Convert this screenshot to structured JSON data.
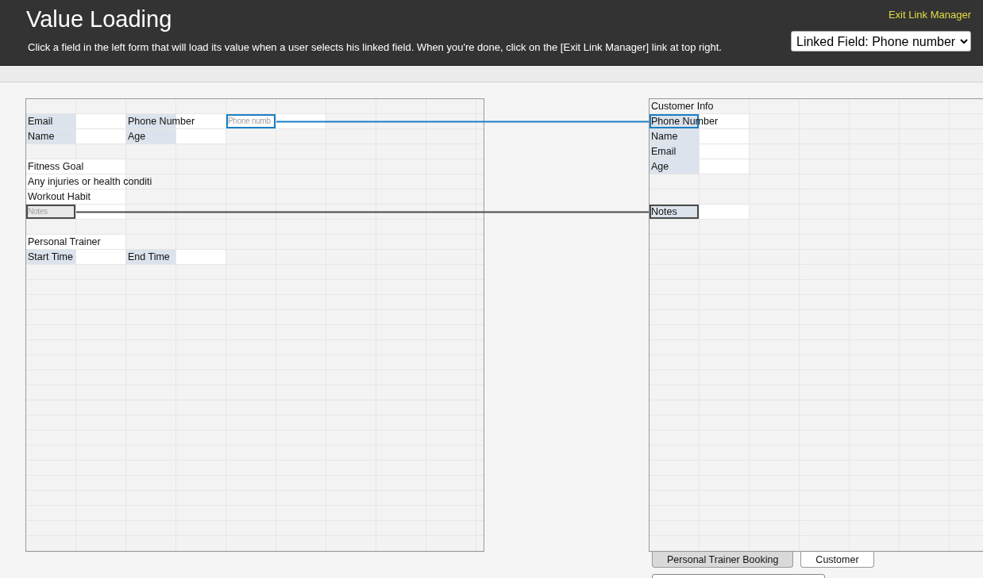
{
  "header": {
    "title": "Value Loading",
    "instruction": "Click a field in the left form that will load its value when a user selects his linked field. When you're done, click on the [Exit Link Manager] link at top right.",
    "exit_link": "Exit Link Manager",
    "linked_field": "Linked Field: Phone number"
  },
  "links": [
    {
      "selected": true
    },
    {
      "selected": false
    }
  ],
  "left_form": {
    "rows": [
      {
        "kind": "blank"
      },
      {
        "kind": "fields",
        "cells": [
          {
            "kind": "label",
            "text": "Email"
          },
          {
            "kind": "input"
          },
          {
            "kind": "label",
            "text": "Phone Number"
          },
          {
            "kind": "input"
          },
          {
            "kind": "input",
            "placeholder": "Phone numb",
            "linked": true
          },
          {
            "kind": "input"
          }
        ]
      },
      {
        "kind": "fields",
        "cells": [
          {
            "kind": "label",
            "text": "Name"
          },
          {
            "kind": "input"
          },
          {
            "kind": "label",
            "text": "Age"
          },
          {
            "kind": "input"
          }
        ]
      },
      {
        "kind": "blank"
      },
      {
        "kind": "fields",
        "cells": [
          {
            "kind": "wide-text",
            "text": "Fitness Goal"
          }
        ]
      },
      {
        "kind": "fields",
        "cells": [
          {
            "kind": "wide-text",
            "text": "Any injuries or health conditi"
          }
        ]
      },
      {
        "kind": "fields",
        "cells": [
          {
            "kind": "wide-text",
            "text": "Workout Habit"
          }
        ]
      },
      {
        "kind": "fields",
        "cells": [
          {
            "kind": "input",
            "placeholder": "Notes",
            "disabled": true,
            "linked": true
          },
          {
            "kind": "input"
          }
        ]
      },
      {
        "kind": "blank"
      },
      {
        "kind": "fields",
        "cells": [
          {
            "kind": "wide-text",
            "text": "Personal Trainer"
          }
        ]
      },
      {
        "kind": "fields",
        "cells": [
          {
            "kind": "label",
            "text": "Start Time"
          },
          {
            "kind": "input"
          },
          {
            "kind": "label",
            "text": "End Time"
          },
          {
            "kind": "input"
          }
        ]
      }
    ]
  },
  "right_form": {
    "rows": [
      {
        "kind": "fields",
        "cells": [
          {
            "kind": "heading",
            "text": "Customer Info"
          }
        ]
      },
      {
        "kind": "fields",
        "cells": [
          {
            "kind": "label",
            "text": "Phone Number",
            "linked": true
          },
          {
            "kind": "input"
          }
        ]
      },
      {
        "kind": "fields",
        "cells": [
          {
            "kind": "label",
            "text": "Name"
          },
          {
            "kind": "input"
          }
        ]
      },
      {
        "kind": "fields",
        "cells": [
          {
            "kind": "label",
            "text": "Email"
          },
          {
            "kind": "input"
          }
        ]
      },
      {
        "kind": "fields",
        "cells": [
          {
            "kind": "label",
            "text": "Age"
          },
          {
            "kind": "input"
          }
        ]
      },
      {
        "kind": "blank"
      },
      {
        "kind": "blank"
      },
      {
        "kind": "fields",
        "cells": [
          {
            "kind": "label",
            "text": "Notes",
            "linked": true
          },
          {
            "kind": "input"
          }
        ]
      }
    ]
  },
  "tabs": [
    {
      "label": "Personal Trainer Booking",
      "selected": true
    },
    {
      "label": "Customer",
      "selected": false
    }
  ]
}
